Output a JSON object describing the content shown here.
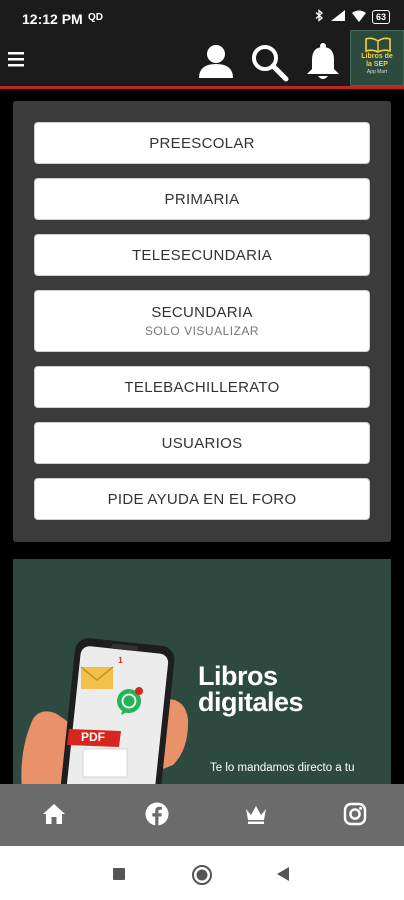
{
  "status": {
    "time": "12:12 PM",
    "extra": "QD",
    "battery": "63"
  },
  "appbar": {
    "brand_line1": "Libros de",
    "brand_line2": "la SEP",
    "brand_line3": "App Mart"
  },
  "menu": {
    "items": [
      {
        "label": "PREESCOLAR",
        "sub": ""
      },
      {
        "label": "PRIMARIA",
        "sub": ""
      },
      {
        "label": "TELESECUNDARIA",
        "sub": ""
      },
      {
        "label": "SECUNDARIA",
        "sub": "SOLO VISUALIZAR"
      },
      {
        "label": "TELEBACHILLERATO",
        "sub": ""
      },
      {
        "label": "USUARIOS",
        "sub": ""
      },
      {
        "label": "PIDE AYUDA EN EL FORO",
        "sub": ""
      }
    ]
  },
  "promo": {
    "title_line1": "Libros",
    "title_line2": "digitales",
    "badge": "1",
    "pdf_label": "PDF",
    "text": "Te lo mandamos directo a tu"
  },
  "colors": {
    "accent": "#c0261d",
    "promo_bg": "#2e4a40",
    "card_bg": "#3b3b3b"
  }
}
